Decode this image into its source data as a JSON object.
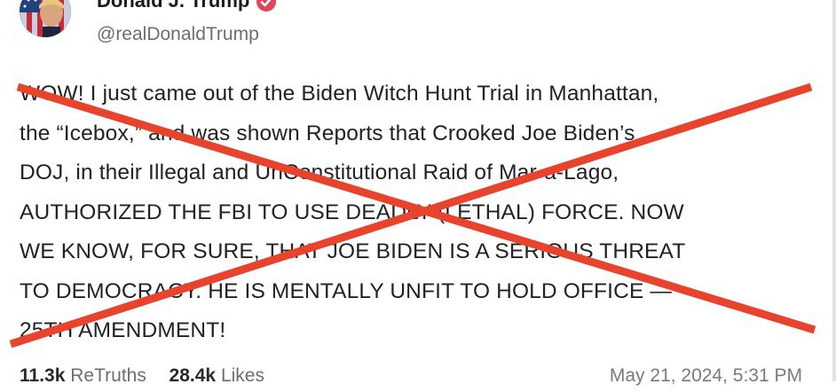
{
  "post": {
    "author_name": "Donald J. Trump",
    "handle": "@realDonaldTrump",
    "text_lines": [
      "WOW! I just came out of the Biden Witch Hunt Trial in Manhattan,",
      "the “Icebox,” and was shown Reports that Crooked Joe Biden’s",
      "DOJ, in their Illegal and UnConstitutional Raid of Mar-a-Lago,",
      "AUTHORIZED THE FBI TO USE DEADLY (LETHAL) FORCE. NOW",
      "WE KNOW, FOR SURE, THAT JOE BIDEN IS A SERIOUS THREAT",
      "TO DEMOCRACY. HE IS MENTALLY UNFIT TO HOLD OFFICE —",
      "25TH AMENDMENT!"
    ],
    "retruths_count": "11.3k",
    "retruths_label": "ReTruths",
    "likes_count": "28.4k",
    "likes_label": "Likes",
    "timestamp": "May 21, 2024, 5:31 PM"
  },
  "overlay": {
    "type": "red-x",
    "color": "#e8432d"
  },
  "colors": {
    "verified_badge": "#e0455c",
    "handle_text": "#6e6e6e"
  }
}
